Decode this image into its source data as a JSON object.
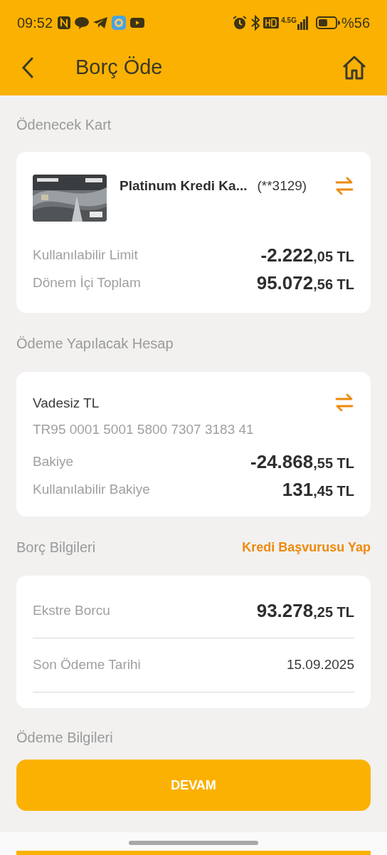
{
  "status_bar": {
    "time": "09:52",
    "network": "4.5G",
    "battery_text": "%56"
  },
  "header": {
    "title": "Borç Öde"
  },
  "card_section": {
    "label": "Ödenecek Kart",
    "card_name": "Platinum Kredi Ka...",
    "card_number": "(**3129)",
    "rows": [
      {
        "label": "Kullanılabilir Limit",
        "amount": "-2.222",
        "fraction": ",05 TL"
      },
      {
        "label": "Dönem İçi Toplam",
        "amount": "95.072",
        "fraction": ",56 TL"
      }
    ]
  },
  "account_section": {
    "label": "Ödeme Yapılacak Hesap",
    "account_name": "Vadesiz TL",
    "iban": "TR95 0001 5001 5800 7307 3183 41",
    "rows": [
      {
        "label": "Bakiye",
        "amount": "-24.868",
        "fraction": ",55 TL"
      },
      {
        "label": "Kullanılabilir Bakiye",
        "amount": "131",
        "fraction": ",45 TL"
      }
    ]
  },
  "debt_section": {
    "label": "Borç Bilgileri",
    "link": "Kredi Başvurusu Yap",
    "rows": [
      {
        "kind": "amount",
        "label": "Ekstre Borcu",
        "amount": "93.278",
        "fraction": ",25 TL"
      },
      {
        "kind": "date",
        "label": "Son Ödeme Tarihi",
        "value": "15.09.2025"
      }
    ]
  },
  "payment_section": {
    "label": "Ödeme Bilgileri"
  },
  "button": "DEVAM"
}
